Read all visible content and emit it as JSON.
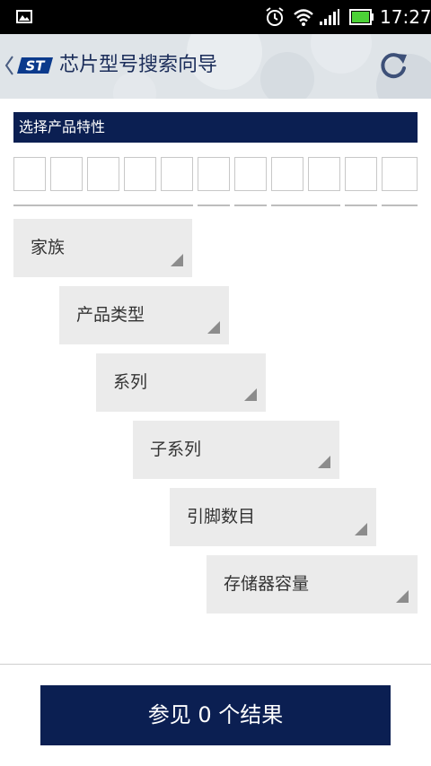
{
  "status_bar": {
    "time": "17:27",
    "icons": [
      "picture-icon",
      "alarm-icon",
      "wifi-icon",
      "signal-icon",
      "battery-icon"
    ],
    "battery_color": "#4cd137"
  },
  "title_bar": {
    "title": "芯片型号搜索向导",
    "logo_text": "ST",
    "icons": [
      "back-chevron-icon",
      "st-logo",
      "refresh-icon"
    ],
    "title_color": "#1b2d5a"
  },
  "section": {
    "header": "选择产品特性",
    "code_box_count": 11
  },
  "dropdowns": [
    {
      "label": "家族"
    },
    {
      "label": "产品类型"
    },
    {
      "label": "系列"
    },
    {
      "label": "子系列"
    },
    {
      "label": "引脚数目"
    },
    {
      "label": "存储器容量"
    }
  ],
  "footer": {
    "results_button": "参见 0 个结果"
  },
  "colors": {
    "accent": "#0b1f52",
    "dropdown_bg": "#ebebeb",
    "corner_triangle": "#8c8c8c"
  }
}
